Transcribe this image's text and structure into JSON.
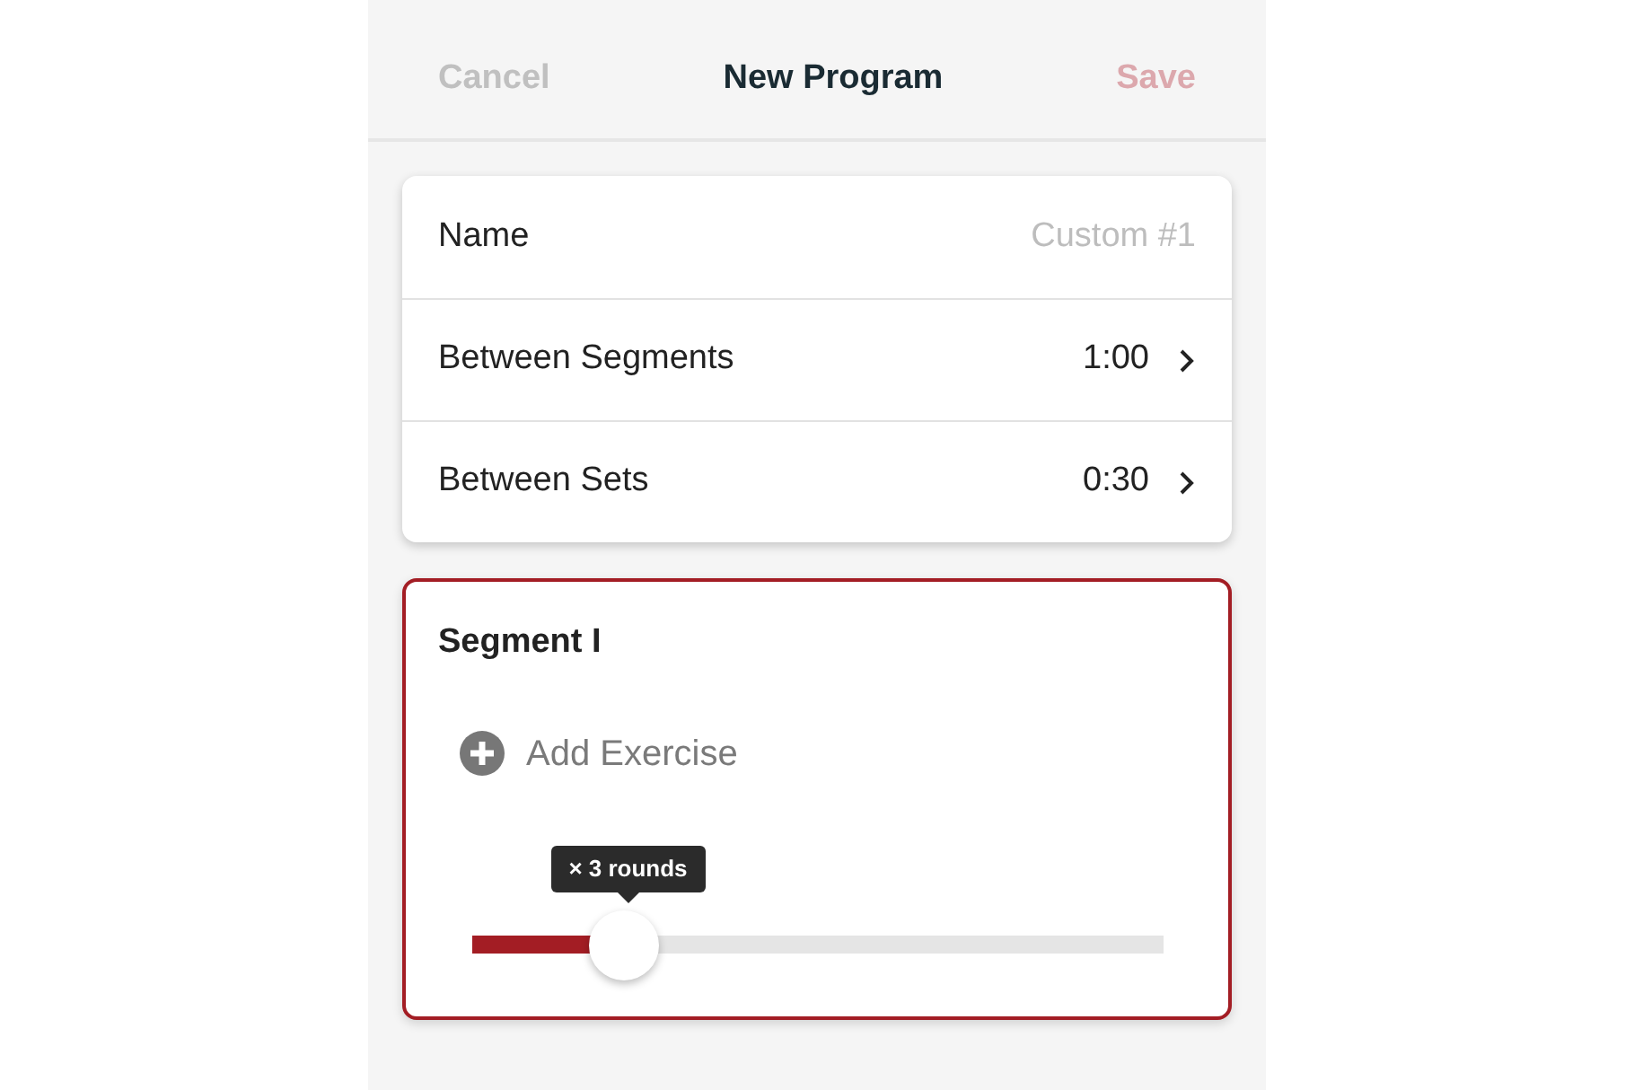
{
  "header": {
    "cancel": "Cancel",
    "title": "New Program",
    "save": {
      "label": "Save",
      "disabled": true
    }
  },
  "settings": [
    {
      "kind": "field",
      "label": "Name",
      "placeholder": "Custom #1"
    },
    {
      "kind": "link",
      "label": "Between Segments",
      "value": "1:00"
    },
    {
      "kind": "link",
      "label": "Between Sets",
      "value": "0:30"
    }
  ],
  "segment": {
    "title": "Segment I",
    "add_label": "Add Exercise",
    "slider": {
      "tooltip": "× 3 rounds",
      "level": 0.22
    }
  }
}
